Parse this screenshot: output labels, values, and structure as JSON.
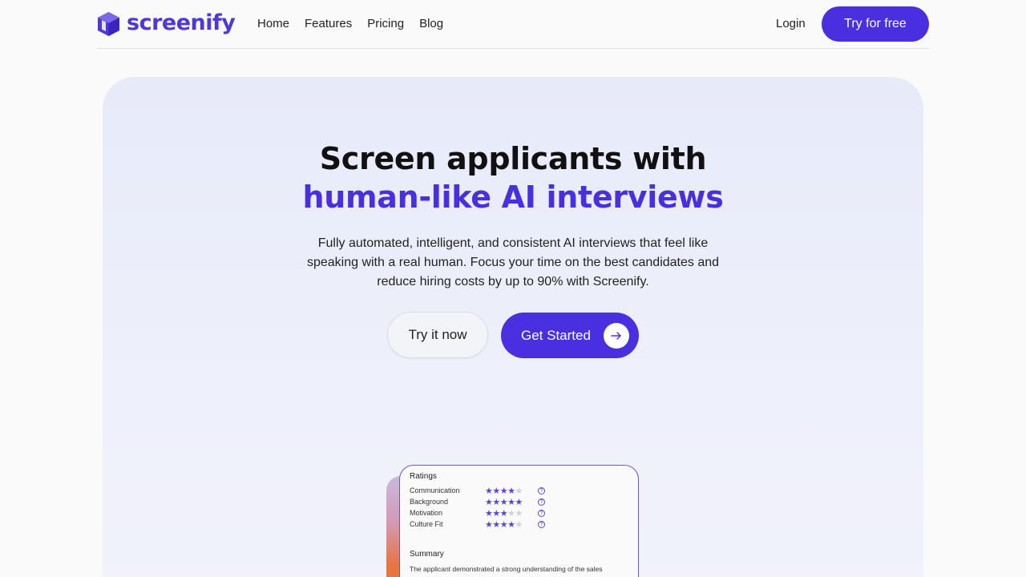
{
  "brand": {
    "name": "screenify",
    "accent": "#4a2fe0"
  },
  "nav": {
    "links": [
      "Home",
      "Features",
      "Pricing",
      "Blog"
    ],
    "login": "Login",
    "cta": "Try for free"
  },
  "hero": {
    "headline_line1": "Screen applicants with",
    "headline_line2": "human-like AI interviews",
    "subtext": "Fully automated, intelligent, and consistent AI interviews that feel like speaking with a real human. Focus your time on the best candidates and reduce hiring costs by up to 90% with Screenify.",
    "try_button": "Try it now",
    "start_button": "Get Started"
  },
  "card": {
    "ratings_title": "Ratings",
    "ratings": [
      {
        "label": "Communication",
        "stars": 4,
        "max": 5
      },
      {
        "label": "Background",
        "stars": 5,
        "max": 5
      },
      {
        "label": "Motivation",
        "stars": 3,
        "max": 5
      },
      {
        "label": "Culture Fit",
        "stars": 4,
        "max": 5
      }
    ],
    "help_symbol": "?",
    "summary_title": "Summary",
    "summary_text": "The applicant demonstrated a strong understanding of the sales"
  }
}
